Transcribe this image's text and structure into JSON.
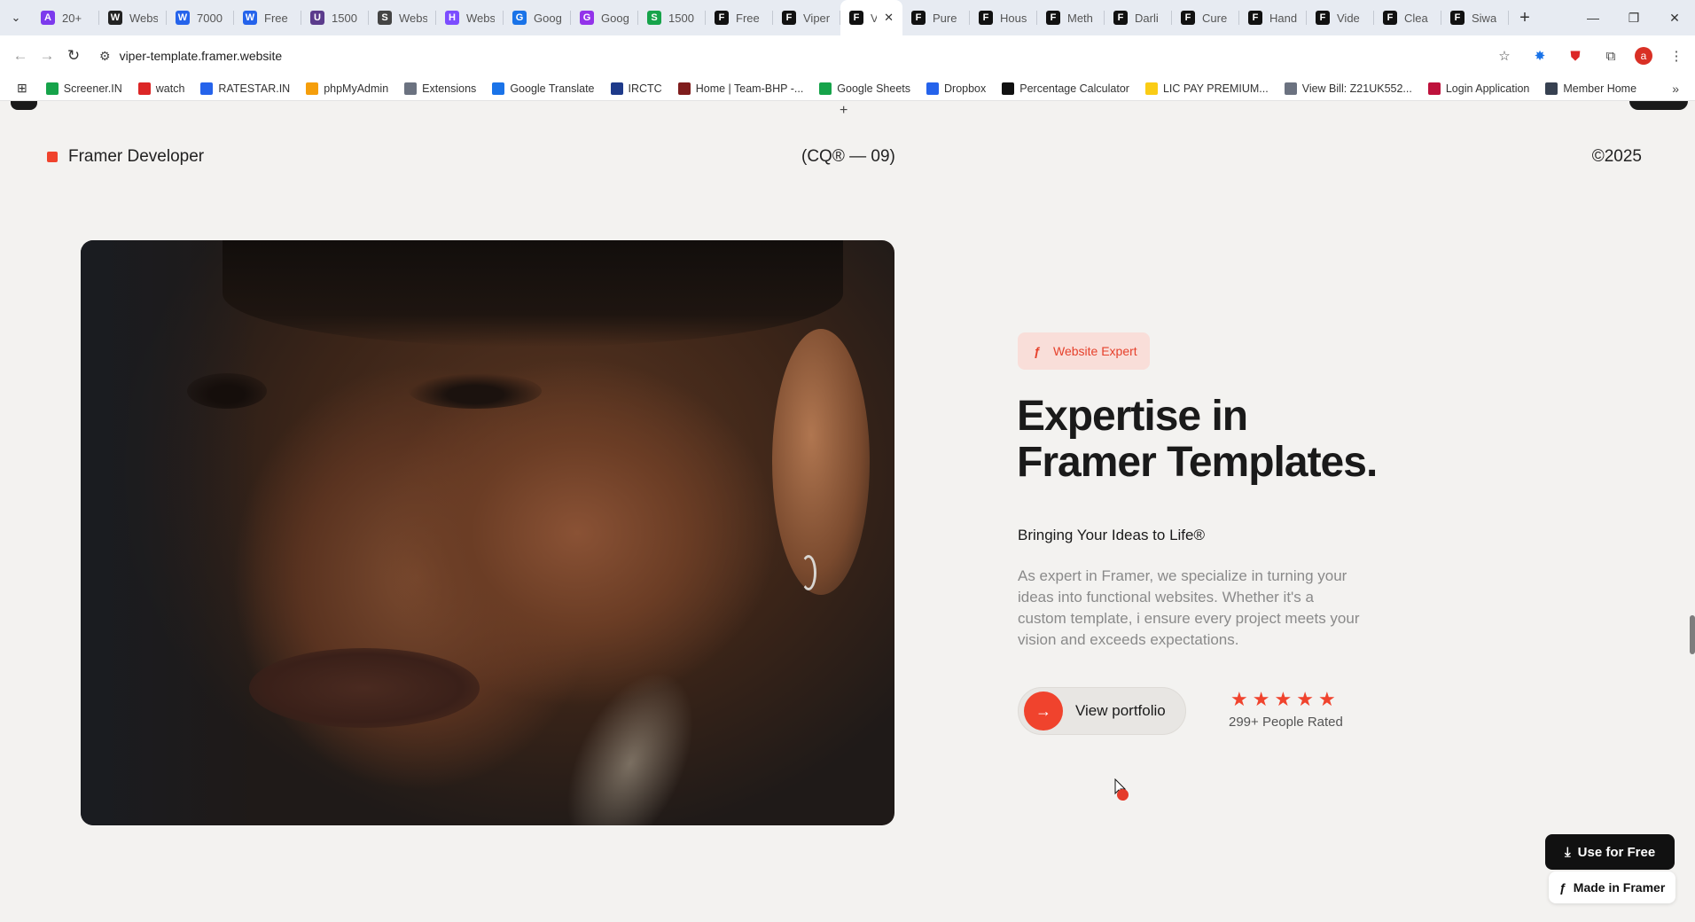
{
  "browser": {
    "tabs": [
      {
        "title": "20+",
        "color": "#7c3aed",
        "glyph": "A"
      },
      {
        "title": "Webs",
        "color": "#222222",
        "glyph": "W"
      },
      {
        "title": "7000",
        "color": "#2563eb",
        "glyph": "W"
      },
      {
        "title": "Free",
        "color": "#2563eb",
        "glyph": "W"
      },
      {
        "title": "1500",
        "color": "#5b3b8c",
        "glyph": "U"
      },
      {
        "title": "Webs",
        "color": "#444444",
        "glyph": "S"
      },
      {
        "title": "Webs",
        "color": "#7c4dff",
        "glyph": "H"
      },
      {
        "title": "Goog",
        "color": "#1a73e8",
        "glyph": "G"
      },
      {
        "title": "Goog",
        "color": "#9333ea",
        "glyph": "G"
      },
      {
        "title": "1500",
        "color": "#16a34a",
        "glyph": "S"
      },
      {
        "title": "Free",
        "color": "#111111",
        "glyph": "F"
      },
      {
        "title": "Viper",
        "color": "#111111",
        "glyph": "F"
      },
      {
        "title": "V",
        "color": "#111111",
        "glyph": "F",
        "active": true
      },
      {
        "title": "Pure",
        "color": "#111111",
        "glyph": "F"
      },
      {
        "title": "Hous",
        "color": "#111111",
        "glyph": "F"
      },
      {
        "title": "Meth",
        "color": "#111111",
        "glyph": "F"
      },
      {
        "title": "Darli",
        "color": "#111111",
        "glyph": "F"
      },
      {
        "title": "Cure",
        "color": "#111111",
        "glyph": "F"
      },
      {
        "title": "Hand",
        "color": "#111111",
        "glyph": "F"
      },
      {
        "title": "Vide",
        "color": "#111111",
        "glyph": "F"
      },
      {
        "title": "Clea",
        "color": "#111111",
        "glyph": "F"
      },
      {
        "title": "Siwa",
        "color": "#111111",
        "glyph": "F"
      }
    ],
    "url": "viper-template.framer.website",
    "bookmarks": [
      {
        "label": "Screener.IN",
        "color": "#16a34a"
      },
      {
        "label": "watch",
        "color": "#dc2626"
      },
      {
        "label": "RATESTAR.IN",
        "color": "#2563eb"
      },
      {
        "label": "phpMyAdmin",
        "color": "#f59e0b"
      },
      {
        "label": "Extensions",
        "color": "#6b7280"
      },
      {
        "label": "Google Translate",
        "color": "#1a73e8"
      },
      {
        "label": "IRCTC",
        "color": "#1e3a8a"
      },
      {
        "label": "Home | Team-BHP -...",
        "color": "#7f1d1d"
      },
      {
        "label": "Google Sheets",
        "color": "#16a34a"
      },
      {
        "label": "Dropbox",
        "color": "#2563eb"
      },
      {
        "label": "Percentage Calculator",
        "color": "#111111"
      },
      {
        "label": "LIC PAY PREMIUM...",
        "color": "#facc15"
      },
      {
        "label": "View Bill: Z21UK552...",
        "color": "#6b7280"
      },
      {
        "label": "Login Application",
        "color": "#be123c"
      },
      {
        "label": "Member Home",
        "color": "#374151"
      }
    ]
  },
  "site": {
    "brand": "Framer Developer",
    "center_code": "(CQ® — 09)",
    "year": "©2025",
    "badge": "Website Expert",
    "headline_line1": "Expertise in",
    "headline_line2": "Framer Templates.",
    "subhead": "Bringing Your Ideas to Life®",
    "description": "As expert in Framer, we specialize in turning your ideas into functional websites. Whether it's a custom template, i ensure every project meets your vision and exceeds expectations.",
    "cta_label": "View portfolio",
    "rating_stars": 5,
    "rating_text": "299+ People Rated",
    "use_free": "Use for Free",
    "made_in": "Made in Framer",
    "accent": "#f0432d"
  }
}
